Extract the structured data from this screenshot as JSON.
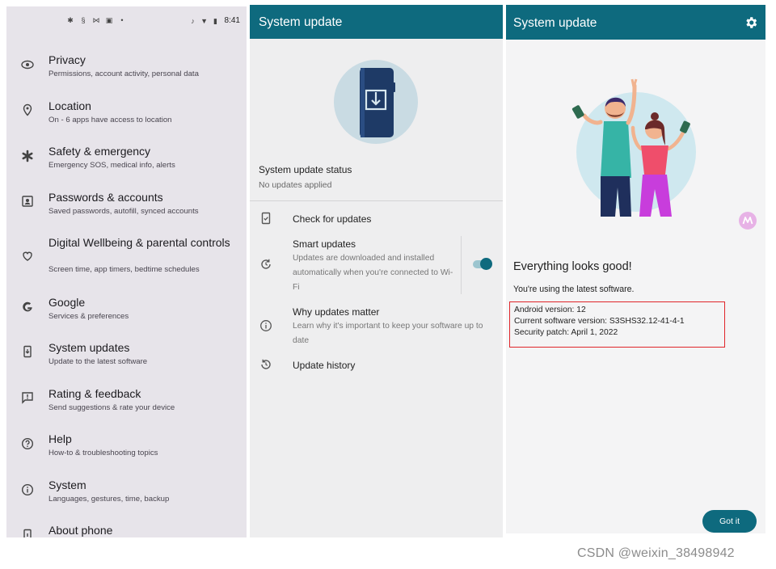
{
  "settings": {
    "statusbar": {
      "time": "8:41"
    },
    "items": [
      {
        "id": "privacy",
        "title": "Privacy",
        "subtitle": "Permissions, account activity, personal data",
        "icon": "eye-icon"
      },
      {
        "id": "location",
        "title": "Location",
        "subtitle": "On - 6 apps have access to location",
        "icon": "location-pin-icon"
      },
      {
        "id": "safety",
        "title": "Safety & emergency",
        "subtitle": "Emergency SOS, medical info, alerts",
        "icon": "asterisk-icon"
      },
      {
        "id": "passwords",
        "title": "Passwords & accounts",
        "subtitle": "Saved passwords, autofill, synced accounts",
        "icon": "account-box-icon"
      },
      {
        "id": "wellbeing",
        "title": "Digital Wellbeing & parental controls",
        "subtitle": "Screen time, app timers, bedtime schedules",
        "icon": "wellbeing-icon"
      },
      {
        "id": "google",
        "title": "Google",
        "subtitle": "Services & preferences",
        "icon": "google-g-icon"
      },
      {
        "id": "system-updates",
        "title": "System updates",
        "subtitle": "Update to the latest software",
        "icon": "phone-download-icon"
      },
      {
        "id": "rating",
        "title": "Rating & feedback",
        "subtitle": "Send suggestions & rate your device",
        "icon": "feedback-icon"
      },
      {
        "id": "help",
        "title": "Help",
        "subtitle": "How-to & troubleshooting topics",
        "icon": "help-circle-icon"
      },
      {
        "id": "system",
        "title": "System",
        "subtitle": "Languages, gestures, time, backup",
        "icon": "info-circle-icon"
      },
      {
        "id": "about",
        "title": "About phone",
        "subtitle": "",
        "icon": "phone-icon"
      }
    ]
  },
  "update_screen": {
    "title": "System update",
    "status_label": "System update status",
    "status_value": "No updates applied",
    "rows": [
      {
        "title": "Check for updates",
        "subtitle": "",
        "icon": "check-phone-icon"
      },
      {
        "title": "Smart updates",
        "subtitle": "Updates are downloaded and installed automatically when you're connected to Wi-Fi",
        "icon": "refresh-clock-icon",
        "toggle_on": true
      },
      {
        "title": "Why updates matter",
        "subtitle": "Learn why it's important to keep your software up to date",
        "icon": "info-circle-icon"
      },
      {
        "title": "Update history",
        "subtitle": "",
        "icon": "history-icon"
      }
    ],
    "colors": {
      "appbar": "#0e6a7e",
      "toggle_on": "#0e6a7e"
    }
  },
  "result_screen": {
    "title": "System update",
    "headline": "Everything looks good!",
    "subtitle": "You're using the latest software.",
    "info": {
      "android_version": "Android version: 12",
      "software_version": "Current software version: S3SHS32.12-41-4-1",
      "security_patch": "Security patch: April 1, 2022"
    },
    "button": "Got it",
    "highlight_color": "#e0252a"
  },
  "watermark": "CSDN @weixin_38498942"
}
